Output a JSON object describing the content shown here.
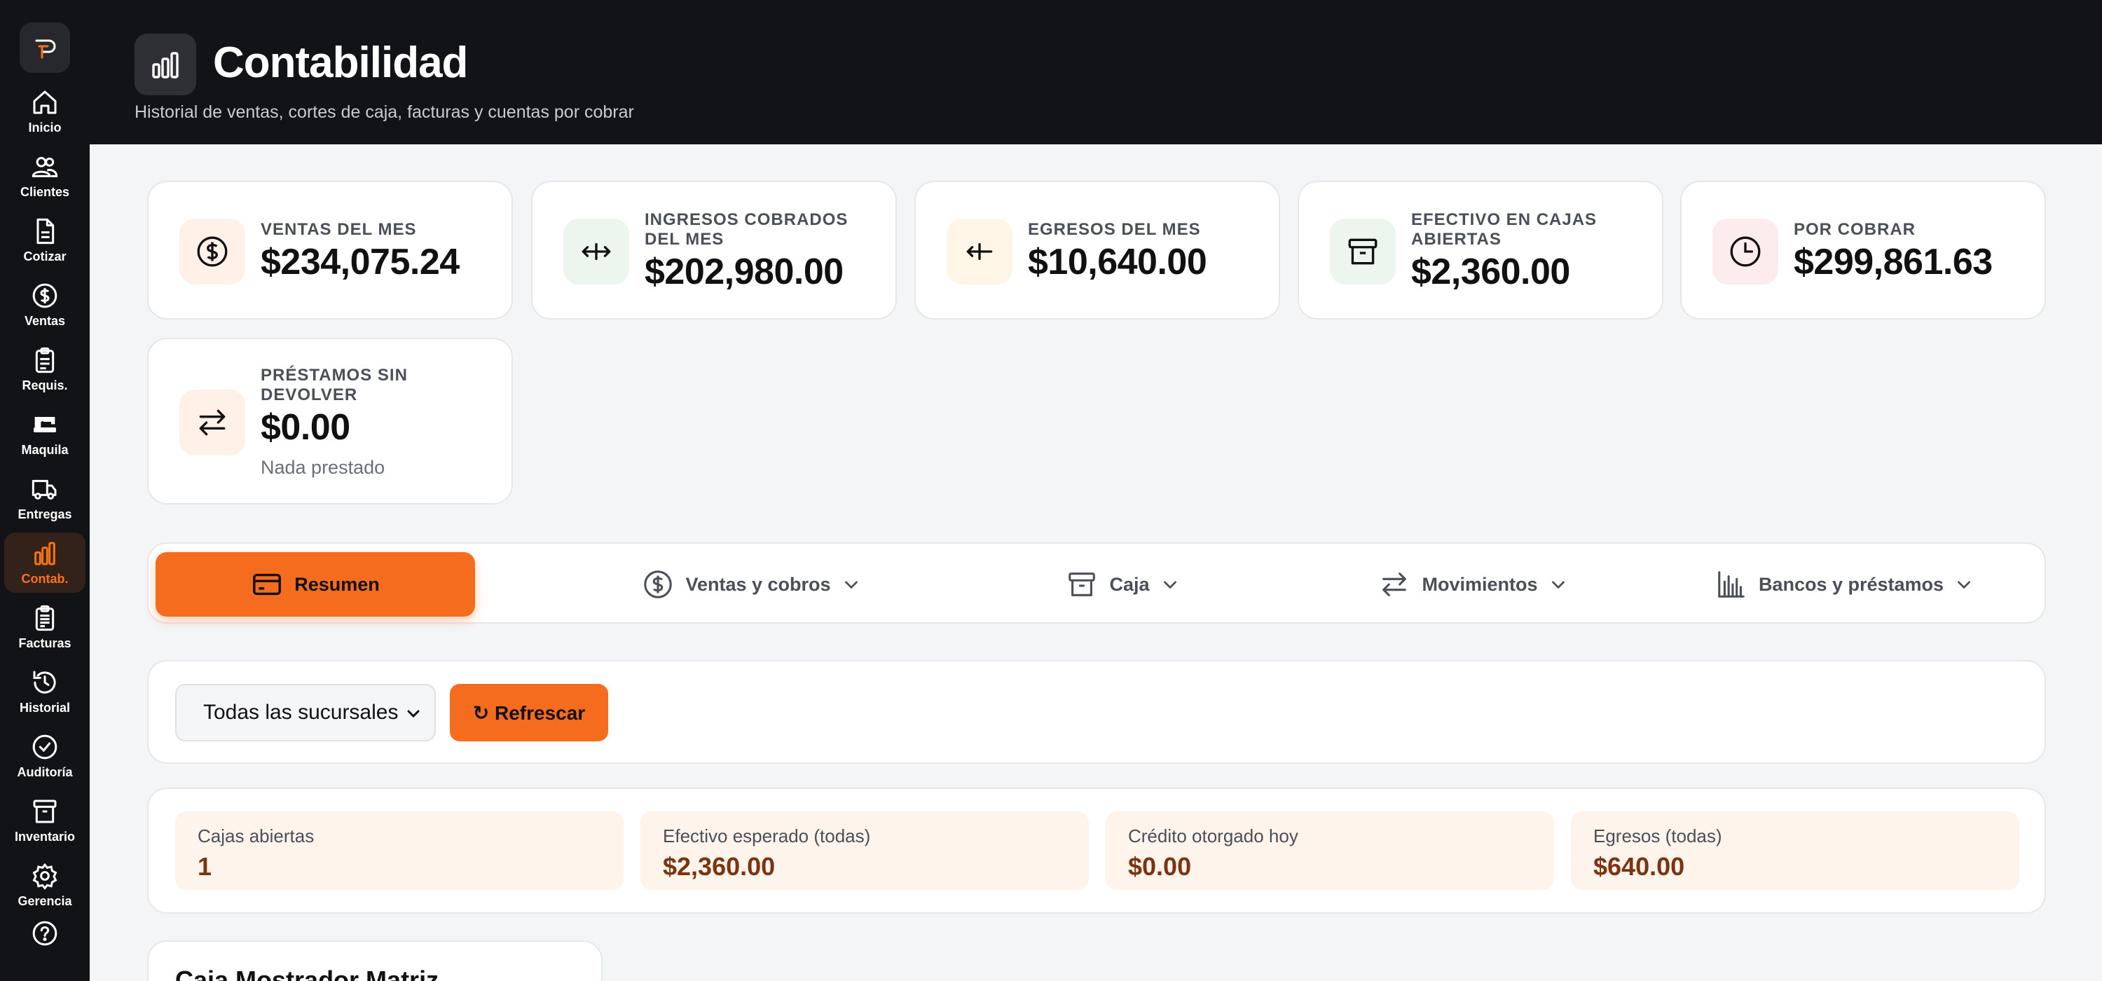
{
  "sidebar": {
    "items": [
      {
        "label": "Inicio",
        "icon": "home-icon"
      },
      {
        "label": "Clientes",
        "icon": "users-icon"
      },
      {
        "label": "Cotizar",
        "icon": "document-icon"
      },
      {
        "label": "Ventas",
        "icon": "dollar-icon"
      },
      {
        "label": "Requis.",
        "icon": "clipboard-icon"
      },
      {
        "label": "Maquila",
        "icon": "sewing-machine-icon"
      },
      {
        "label": "Entregas",
        "icon": "truck-icon"
      },
      {
        "label": "Contab.",
        "icon": "bar-chart-icon",
        "active": true
      },
      {
        "label": "Facturas",
        "icon": "invoice-icon"
      },
      {
        "label": "Historial",
        "icon": "history-icon"
      },
      {
        "label": "Auditoría",
        "icon": "check-circle-icon"
      },
      {
        "label": "Inventario",
        "icon": "archive-icon"
      },
      {
        "label": "Gerencia",
        "icon": "gear-icon"
      }
    ]
  },
  "header": {
    "title": "Contabilidad",
    "subtitle": "Historial de ventas, cortes de caja, facturas y cuentas por cobrar"
  },
  "stats": [
    {
      "label": "VENTAS DEL MES",
      "value": "$234,075.24",
      "icon": "dollar-icon"
    },
    {
      "label": "INGRESOS COBRADOS DEL MES",
      "value": "$202,980.00",
      "icon": "arrows-in-icon"
    },
    {
      "label": "EGRESOS DEL MES",
      "value": "$10,640.00",
      "icon": "arrow-out-icon"
    },
    {
      "label": "EFECTIVO EN CAJAS ABIERTAS",
      "value": "$2,360.00",
      "icon": "archive-icon"
    },
    {
      "label": "POR COBRAR",
      "value": "$299,861.63",
      "icon": "clock-icon"
    },
    {
      "label": "PRÉSTAMOS SIN DEVOLVER",
      "value": "$0.00",
      "note": "Nada prestado",
      "icon": "exchange-icon"
    }
  ],
  "tabs": [
    {
      "label": "Resumen",
      "icon": "card-icon",
      "active": true
    },
    {
      "label": "Ventas y cobros",
      "icon": "dollar-icon"
    },
    {
      "label": "Caja",
      "icon": "archive-icon"
    },
    {
      "label": "Movimientos",
      "icon": "exchange-icon"
    },
    {
      "label": "Bancos y préstamos",
      "icon": "bank-icon"
    }
  ],
  "filters": {
    "branch_select": "Todas las sucursales",
    "refresh_label": "↻ Refrescar"
  },
  "summary": [
    {
      "label": "Cajas abiertas",
      "value": "1"
    },
    {
      "label": "Efectivo esperado (todas)",
      "value": "$2,360.00"
    },
    {
      "label": "Crédito otorgado hoy",
      "value": "$0.00"
    },
    {
      "label": "Egresos (todas)",
      "value": "$640.00"
    }
  ],
  "box_card": {
    "title": "Caja Mostrador Matriz"
  },
  "colors": {
    "accent": "#f56c1f",
    "sidebar_bg": "#121316",
    "summary_tile_bg": "#fff4ec",
    "summary_value": "#7a3510"
  }
}
